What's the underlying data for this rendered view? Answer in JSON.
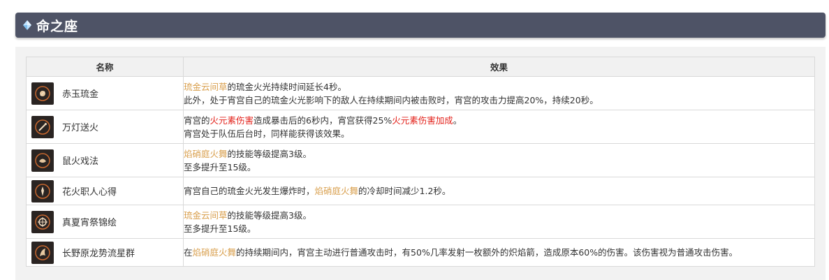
{
  "section": {
    "title": "命之座"
  },
  "table": {
    "headers": {
      "name": "名称",
      "effect": "效果"
    },
    "rows": [
      {
        "name": "赤玉琉金",
        "icon": "constellation-1-icon",
        "lines": [
          [
            {
              "t": "琉金云间草",
              "s": "gold"
            },
            {
              "t": "的琉金火光持续时间延长4秒。",
              "s": ""
            }
          ],
          [
            {
              "t": "此外，处于宵宫自己的琉金火光影响下的敌人在持续期间内被击败时，宵宫的攻击力提高20%，持续20秒。",
              "s": ""
            }
          ]
        ]
      },
      {
        "name": "万灯送火",
        "icon": "constellation-2-icon",
        "lines": [
          [
            {
              "t": "宵宫的",
              "s": ""
            },
            {
              "t": "火元素伤害",
              "s": "red"
            },
            {
              "t": "造成暴击后的6秒内，宵宫获得25%",
              "s": ""
            },
            {
              "t": "火元素伤害加成",
              "s": "red"
            },
            {
              "t": "。",
              "s": ""
            }
          ],
          [
            {
              "t": "宵宫处于队伍后台时，同样能获得该效果。",
              "s": ""
            }
          ]
        ]
      },
      {
        "name": "鼠火戏法",
        "icon": "constellation-3-icon",
        "lines": [
          [
            {
              "t": "焰硝庭火舞",
              "s": "gold"
            },
            {
              "t": "的技能等级提高3级。",
              "s": ""
            }
          ],
          [
            {
              "t": "至多提升至15级。",
              "s": ""
            }
          ]
        ]
      },
      {
        "name": "花火职人心得",
        "icon": "constellation-4-icon",
        "lines": [
          [
            {
              "t": "宵宫自己的琉金火光发生爆炸时，",
              "s": ""
            },
            {
              "t": "焰硝庭火舞",
              "s": "gold"
            },
            {
              "t": "的冷却时间减少1.2秒。",
              "s": ""
            }
          ]
        ]
      },
      {
        "name": "真夏宵祭锦绘",
        "icon": "constellation-5-icon",
        "lines": [
          [
            {
              "t": "琉金云间草",
              "s": "gold"
            },
            {
              "t": "的技能等级提高3级。",
              "s": ""
            }
          ],
          [
            {
              "t": "至多提升至15级。",
              "s": ""
            }
          ]
        ]
      },
      {
        "name": "长野原龙势流星群",
        "icon": "constellation-6-icon",
        "lines": [
          [
            {
              "t": "在",
              "s": ""
            },
            {
              "t": "焰硝庭火舞",
              "s": "gold"
            },
            {
              "t": "的持续期间内，宵宫主动进行普通攻击时，有50%几率发射一枚额外的炽焰箭，造成原本60%的伤害。该伤害视为普通攻击伤害。",
              "s": ""
            }
          ]
        ]
      }
    ]
  }
}
